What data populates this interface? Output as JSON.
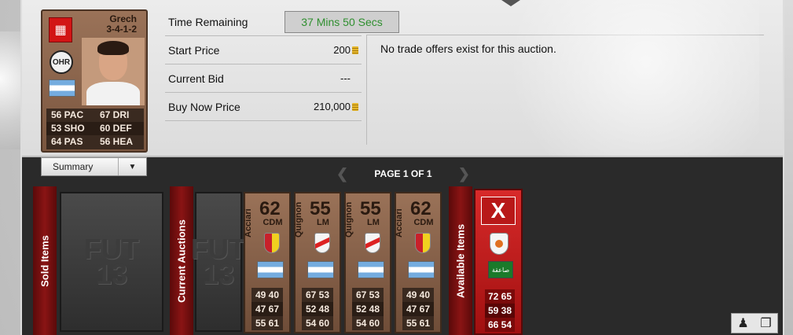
{
  "player": {
    "name": "Grech",
    "formation": "3-4-1-2",
    "club_badge_text": "OHR",
    "stats": [
      [
        "56 PAC",
        "67 DRI"
      ],
      [
        "53 SHO",
        "60 DEF"
      ],
      [
        "64 PAS",
        "56 HEA"
      ]
    ]
  },
  "summary_select": {
    "selected": "Summary"
  },
  "auction": {
    "time_label": "Time Remaining",
    "time_value": "37 Mins 50 Secs",
    "start_label": "Start Price",
    "start_value": "200",
    "bid_label": "Current Bid",
    "bid_value": "---",
    "buynow_label": "Buy Now Price",
    "buynow_value": "210,000",
    "offers_message": "No trade offers exist for this auction."
  },
  "pager": {
    "text": "PAGE 1 OF 1"
  },
  "sections": {
    "sold": "Sold Items",
    "current": "Current Auctions",
    "available": "Available Items"
  },
  "fut_logo": {
    "line1": "FUT",
    "line2": "13"
  },
  "auction_cards": [
    {
      "name": "Acciari",
      "rating": "62",
      "pos": "CDM",
      "club": "murcia",
      "stats": [
        "49 40",
        "47 67",
        "55 61"
      ]
    },
    {
      "name": "Quignon",
      "rating": "55",
      "pos": "LM",
      "club": "river",
      "stats": [
        "67 53",
        "52 48",
        "54 60"
      ]
    },
    {
      "name": "Quignon",
      "rating": "55",
      "pos": "LM",
      "club": "river",
      "stats": [
        "67 53",
        "52 48",
        "54 60"
      ]
    },
    {
      "name": "Acciari",
      "rating": "62",
      "pos": "CDM",
      "club": "murcia",
      "stats": [
        "49 40",
        "47 67",
        "55 61"
      ]
    }
  ],
  "available_card": {
    "remove_label": "X",
    "flag_text": "صاعقة",
    "stats": [
      "72 65",
      "59 38",
      "66 54"
    ]
  },
  "colors": {
    "accent_red": "#a01010",
    "time_green": "#2f8f2f",
    "card_bronze": "#9a7258"
  }
}
